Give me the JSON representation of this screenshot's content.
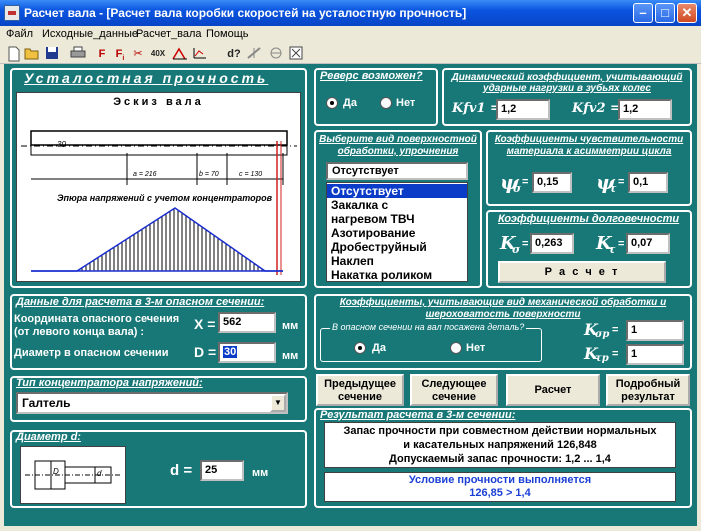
{
  "window": {
    "title": "Расчет вала - [Расчет вала коробки скоростей на усталостную прочность]"
  },
  "menu": [
    "Файл",
    "Исходные_данные",
    "Расчет_вала",
    "Помощь"
  ],
  "toolbar_icons": [
    "new-icon",
    "open-icon",
    "save-icon",
    "print-icon",
    "force-icon",
    "moment-icon",
    "cut-icon",
    "scale-icon",
    "diagram-icon",
    "help-icon",
    "settings-icon",
    "close-doc-icon"
  ],
  "fatigue": {
    "title": "Усталостная прочность",
    "sketch_title": "Эскиз вала",
    "dim_30": "30",
    "dim_a": "a = 216",
    "dim_b": "b = 70",
    "dim_c": "c = 130",
    "diagram_title": "Эпюра напряжений с учетом концентраторов"
  },
  "data_section": {
    "title": "Данные для расчета в 3-м опасном сечении:",
    "coord_label_1": "Координата опасного сечения",
    "coord_label_2": "(от левого конца вала) :",
    "x_symbol": "X =",
    "x_value": "562",
    "x_unit": "мм",
    "diam_label": "Диаметр в опасном сечении",
    "d_symbol": "D =",
    "d_value": "30",
    "d_unit": "мм"
  },
  "concentrator": {
    "title": "Тип концентратора напряжений:",
    "value": "Галтель"
  },
  "diameter": {
    "title": "Диаметр d:",
    "d_symbol": "d =",
    "d_value": "25",
    "unit": "мм",
    "D_mark": "D",
    "d_mark": "d"
  },
  "reverse": {
    "title": "Реверс возможен?",
    "yes": "Да",
    "no": "Нет"
  },
  "dynamic": {
    "title_1": "Динамический коэффициент, учитывающий",
    "title_2": "ударные нагрузки в зубьях колес",
    "kfv1_label": "Kfv1 =",
    "kfv1_value": "1,2",
    "kfv2_label": "Kfv2 =",
    "kfv2_value": "1,2"
  },
  "surface": {
    "title_1": "Выберите вид поверхностной",
    "title_2": "обработки, упрочнения",
    "selected": "Отсутствует",
    "options": [
      "Отсутствует",
      "Закалка с нагревом ТВЧ",
      "Азотирование",
      "Дробеструйный Наклеп",
      "Накатка роликом"
    ]
  },
  "sensitivity": {
    "title_1": "Коэффициенты чувствительности",
    "title_2": "материала к асимметрии цикла",
    "psi": "ψ",
    "sub_sigma": "σ",
    "sub_tau": "τ",
    "eq": "=",
    "psi_sigma_value": "0,15",
    "psi_tau_value": "0,1"
  },
  "durability": {
    "title": "Коэффициенты долговечности",
    "k": "K",
    "sub_sigma": "σ",
    "sub_tau": "τ",
    "eq": "=",
    "k_sigma_value": "0,263",
    "k_tau_value": "0,07",
    "calc_button": "Р а с ч е т"
  },
  "machining": {
    "title_1": "Коэффициенты, учитывающие вид механической обработки и",
    "title_2": "шероховатость поверхности",
    "fit_question": "В опасном сечении на вал посажена деталь?",
    "yes": "Да",
    "no": "Нет",
    "k": "K",
    "sub_sigma_p": "σр",
    "sub_tau_p": "τр",
    "eq": "=",
    "k_sigma_p_value": "1",
    "k_tau_p_value": "1"
  },
  "actions": {
    "prev": [
      "Предыдущее",
      "сечение"
    ],
    "next": [
      "Следующее",
      "сечение"
    ],
    "calc": "Расчет",
    "detailed": [
      "Подробный",
      "результат"
    ]
  },
  "result": {
    "title": "Результат расчета в 3-м сечении:",
    "line1": "Запас прочности при совместном действии нормальных",
    "line2": "и касательных напряжений  126,848",
    "line3": "Допускаемый запас прочности: 1,2 ... 1,4",
    "status_1": "Условие прочности выполняется",
    "status_2": "126,85 > 1,4",
    "status_color": "#1b3fd6"
  },
  "colors": {
    "teal": "#187878",
    "titlebar": "#0a54e0",
    "diagram_line": "#1a2ed0",
    "diagram_hatch": "#000000",
    "marker_red": "#d02020"
  }
}
